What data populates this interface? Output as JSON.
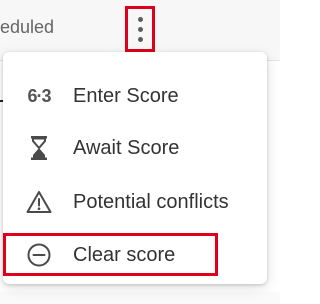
{
  "background": {
    "status_text": "eduled"
  },
  "colors": {
    "highlight": "#e0001b",
    "icon": "#4a4a4a",
    "text": "#333333"
  },
  "menu": {
    "trigger_icon": "more-vertical-icon",
    "items": [
      {
        "label": "Enter Score",
        "icon": "score-icon",
        "glyph": "6·3"
      },
      {
        "label": "Await Score",
        "icon": "hourglass-icon"
      },
      {
        "label": "Potential conflicts",
        "icon": "warning-icon"
      },
      {
        "label": "Clear score",
        "icon": "minus-circle-icon"
      }
    ]
  }
}
